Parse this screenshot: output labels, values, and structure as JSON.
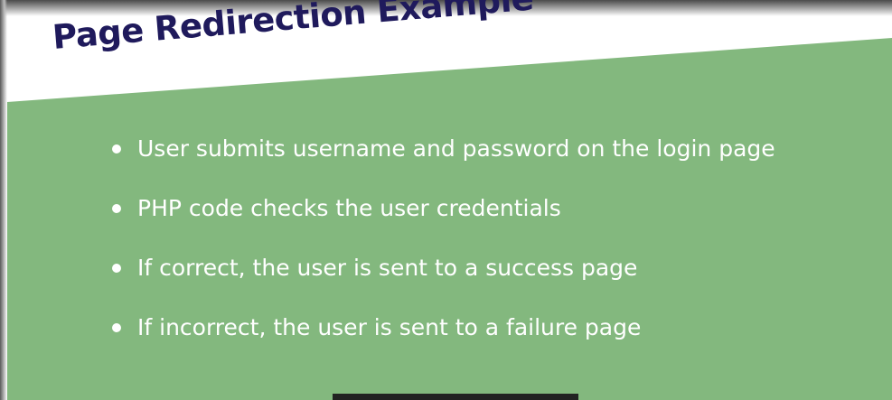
{
  "colors": {
    "slide_green": "#83b87e",
    "title_navy": "#1f1a5c",
    "bullet_text": "#ffffff"
  },
  "slide": {
    "title": "Page Redirection Example",
    "bullets": [
      "User submits username and password on the login page",
      "PHP code checks the user credentials",
      "If correct, the user is sent to a success page",
      "If incorrect, the user is sent to a failure page"
    ]
  }
}
